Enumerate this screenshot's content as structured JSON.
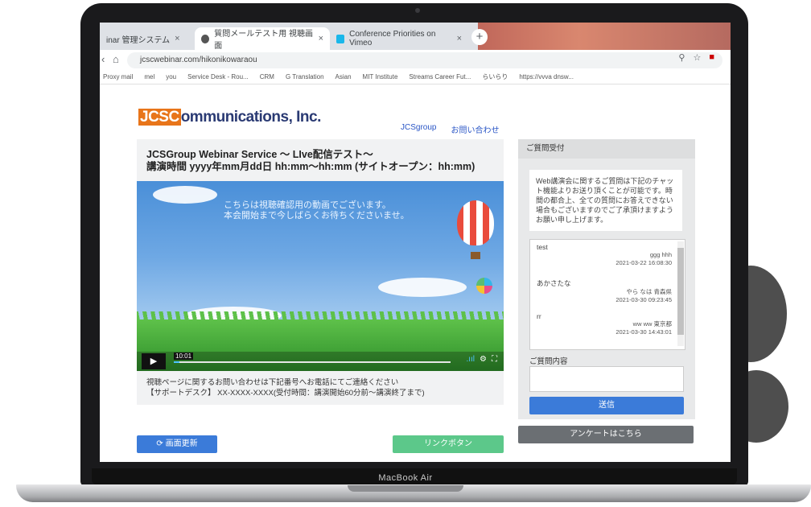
{
  "browser": {
    "tabs": [
      {
        "label": "inar 管理システム",
        "close": "×"
      },
      {
        "label": "質問メールテスト用 視聴画面",
        "close": "×"
      },
      {
        "label": "Conference Priorities on Vimeo",
        "close": "×"
      }
    ],
    "new_tab": "+",
    "url": "jcscwebinar.com/hikonikowaraou",
    "bookmarks": [
      "Proxy mail",
      "mel",
      "you",
      "Service Desk - Rou...",
      "CRM",
      "G Translation",
      "Asian",
      "MIT Institute",
      "Streams Career Fut...",
      "らいらり",
      "https://vvva dnsw..."
    ]
  },
  "page": {
    "logo_box": "JCSC",
    "logo_rest": "ommunications, Inc.",
    "header_links": [
      "JCSgroup",
      "お問い合わせ"
    ],
    "event": {
      "title_line1": "JCSGroup Webinar Service ～ LIve配信テスト～",
      "title_line2": "講演時間 yyyy年mm月dd日 hh:mm～hh:mm (サイトオープン：hh:mm)"
    },
    "video": {
      "message_line1": "こちらは視聴確認用の動画でございます。",
      "message_line2": "本会開始まで今しばらくお待ちくださいませ。",
      "timecode": "10:01",
      "progress_fraction": 0.02
    },
    "support_line1": "視聴ページに関するお問い合わせは下記番号へお電話にてご連絡ください",
    "support_line2": "【サポートデスク】 XX-XXXX-XXXX(受付時間：講演開始60分前～講演終了まで)",
    "refresh_button": "⟳ 画面更新",
    "link_button": "リンクボタン",
    "question_panel": {
      "header": "ご質問受付",
      "notice": "Web講演会に関するご質問は下記のチャット機能よりお送り頂くことが可能です。時間の都合上、全ての質問にお答えできない場合もございますのでご了承頂けますようお願い申し上げます。",
      "messages": [
        {
          "text": "test",
          "author": "ggg hhh",
          "time": "2021-03-22 16:08:30"
        },
        {
          "text": "あかさたな",
          "author": "やら なは 青森県",
          "time": "2021-03-30 09:23:45"
        },
        {
          "text": "rr",
          "author": "ww ww 東京都",
          "time": "2021-03-30 14:43:01"
        }
      ],
      "input_label": "ご質問内容",
      "send_button": "送信"
    },
    "survey_button": "アンケートはこちら"
  },
  "device_label": "MacBook Air"
}
